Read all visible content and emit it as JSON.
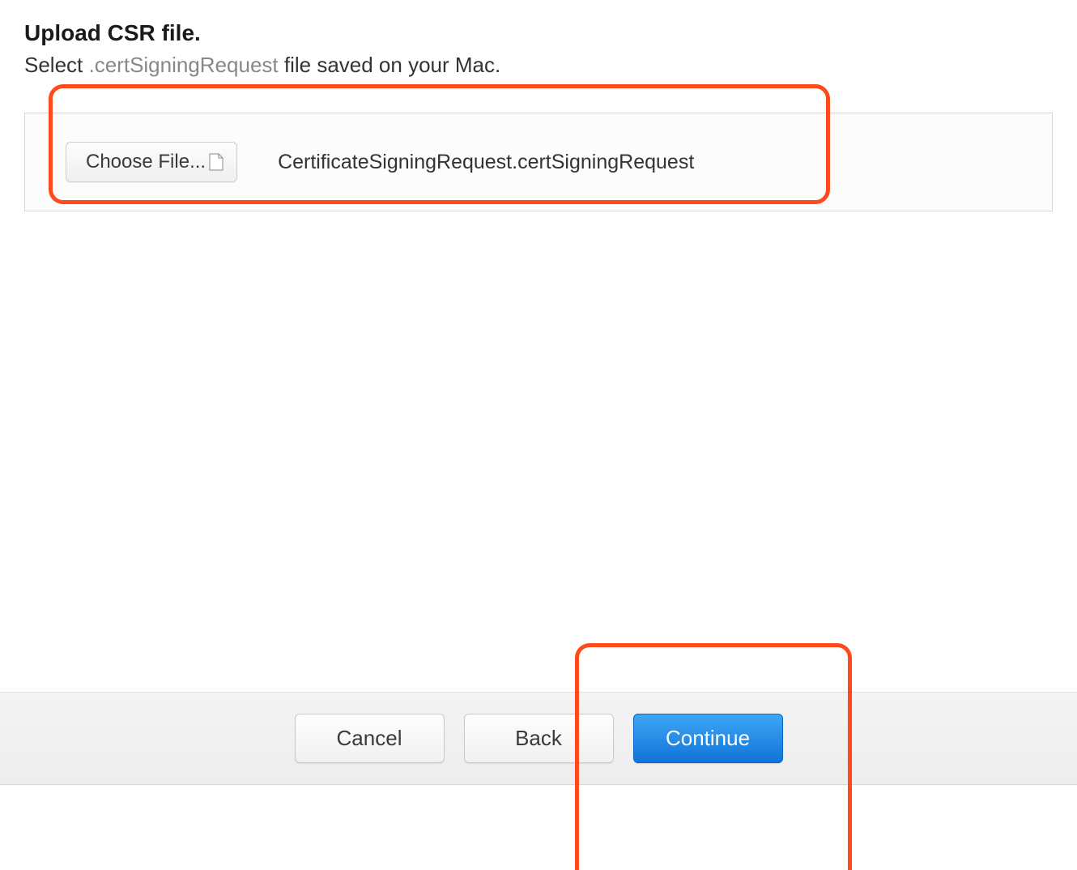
{
  "header": {
    "title": "Upload CSR file.",
    "subtitle_prefix": "Select ",
    "subtitle_ext": ".certSigningRequest",
    "subtitle_suffix": " file saved on your Mac."
  },
  "upload": {
    "choose_label": "Choose File...",
    "filename": "CertificateSigningRequest.certSigningRequest"
  },
  "footer": {
    "cancel_label": "Cancel",
    "back_label": "Back",
    "continue_label": "Continue"
  }
}
